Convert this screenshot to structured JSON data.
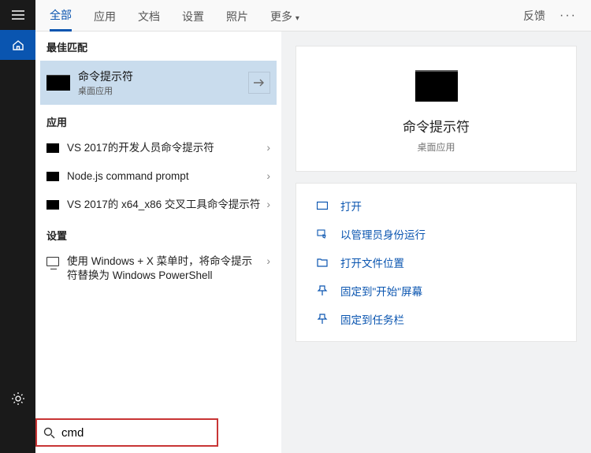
{
  "leftbar": {
    "menu": "menu",
    "home": "home",
    "settings": "settings"
  },
  "tabs": {
    "items": [
      "全部",
      "应用",
      "文档",
      "设置",
      "照片",
      "更多"
    ],
    "feedback": "反馈"
  },
  "sections": {
    "best": "最佳匹配",
    "apps": "应用",
    "settings": "设置"
  },
  "best_match": {
    "title": "命令提示符",
    "subtitle": "桌面应用"
  },
  "apps_list": [
    {
      "label": "VS 2017的开发人员命令提示符"
    },
    {
      "label": "Node.js command prompt"
    },
    {
      "label": "VS 2017的 x64_x86 交叉工具命令提示符"
    }
  ],
  "settings_list": [
    {
      "label": "使用 Windows + X 菜单时，将命令提示符替换为 Windows PowerShell"
    }
  ],
  "preview": {
    "title": "命令提示符",
    "subtitle": "桌面应用"
  },
  "actions": [
    {
      "label": "打开"
    },
    {
      "label": "以管理员身份运行"
    },
    {
      "label": "打开文件位置"
    },
    {
      "label": "固定到\"开始\"屏幕"
    },
    {
      "label": "固定到任务栏"
    }
  ],
  "search": {
    "value": "cmd"
  }
}
